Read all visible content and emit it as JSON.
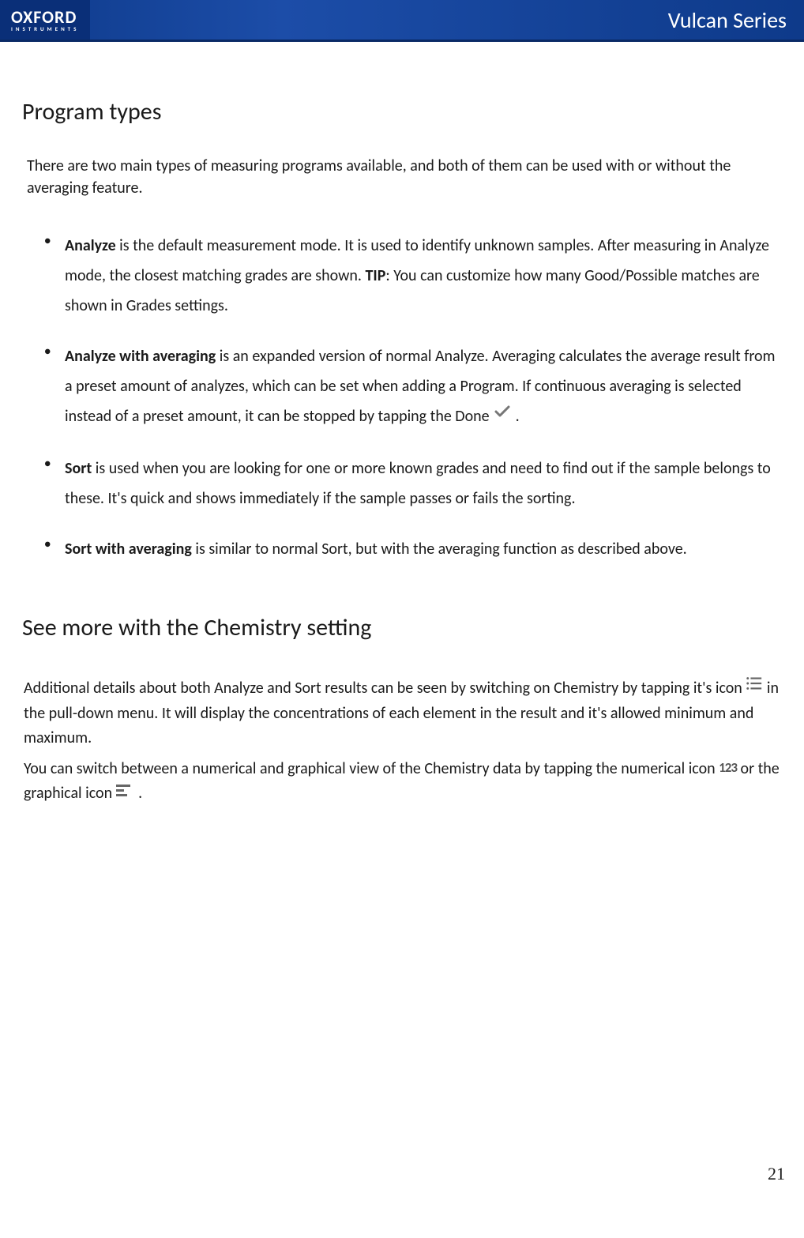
{
  "header": {
    "logo_main": "OXFORD",
    "logo_sub": "INSTRUMENTS",
    "title": "Vulcan Series"
  },
  "section1": {
    "heading": "Program types",
    "intro": "There are two main types of measuring programs available, and both of them can be used with or without the averaging feature.",
    "items": [
      {
        "bold": "Analyze",
        "text_a": " is the default measurement mode. It is used to identify unknown samples. After measuring in Analyze mode, the closest matching grades are shown. ",
        "tip_label": "TIP",
        "text_b": ": You can customize how many Good/Possible matches are shown in Grades settings."
      },
      {
        "bold": "Analyze with averaging",
        "text_a": " is an expanded version of normal Analyze. Averaging calculates the average result from a preset amount of analyzes, which can be set when adding a Program. If continuous averaging is selected instead of a preset amount, it can be stopped by tapping the Done ",
        "text_b": " ."
      },
      {
        "bold": "Sort",
        "text_a": " is used when you are looking for one or more known grades and need to find out if the sample belongs to these. It's quick and shows immediately if the sample passes or fails the sorting."
      },
      {
        "bold": "Sort with averaging",
        "text_a": " is similar to normal Sort, but with the averaging function as described above."
      }
    ]
  },
  "section2": {
    "heading": "See more with the Chemistry setting",
    "para_a": "Additional details about both Analyze and Sort results can be seen by switching on Chemistry by tapping it's icon ",
    "para_b": " in the pull-down menu. It will display the concentrations of each element in the result and it's allowed minimum and  maximum.",
    "para_c": "You can switch between a numerical and graphical view of the Chemistry data by tapping the numerical icon ",
    "num_icon": "123",
    "para_d": " or the graphical icon ",
    "para_e": " ."
  },
  "page_number": "21"
}
